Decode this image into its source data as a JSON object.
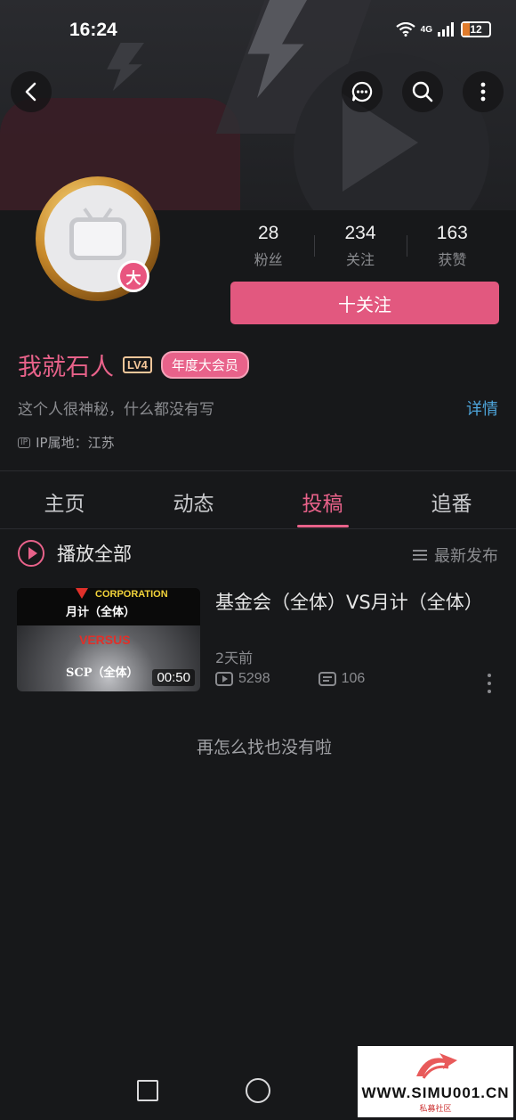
{
  "status_bar": {
    "time": "16:24",
    "network": "4G",
    "battery": "12"
  },
  "profile": {
    "avatar_badge": "大",
    "stats": [
      {
        "value": "28",
        "label": "粉丝"
      },
      {
        "value": "234",
        "label": "关注"
      },
      {
        "value": "163",
        "label": "获赞"
      }
    ],
    "follow_label": "十关注",
    "username": "我就石人",
    "level": "LV4",
    "vip_label": "年度大会员",
    "bio": "这个人很神秘，什么都没有写",
    "detail_label": "详情",
    "ip_icon": "IP",
    "ip_location": "IP属地：江苏"
  },
  "tabs": [
    {
      "label": "主页",
      "active": false
    },
    {
      "label": "动态",
      "active": false
    },
    {
      "label": "投稿",
      "active": true
    },
    {
      "label": "追番",
      "active": false
    }
  ],
  "toolbar": {
    "play_all": "播放全部",
    "sort": "最新发布"
  },
  "videos": [
    {
      "thumb_corp": "CORPORATION",
      "thumb_line1": "月计（全体）",
      "thumb_versus": "VERSUS",
      "thumb_line2": "SCP（全体）",
      "duration": "00:50",
      "title": "基金会（全体）VS月计（全体）",
      "date": "2天前",
      "plays": "5298",
      "danmaku": "106"
    }
  ],
  "empty_text": "再怎么找也没有啦",
  "watermark": {
    "text": "WWW.SIMU001.CN",
    "sub": "私募社区"
  },
  "colors": {
    "accent": "#e8628a",
    "link": "#4ea5db",
    "background": "#17181a"
  }
}
